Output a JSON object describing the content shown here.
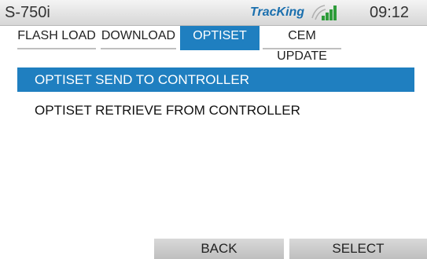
{
  "status_bar": {
    "device": "S-750i",
    "logo": "TracKing",
    "time": "09:12",
    "signal_icon": "signal-bars-icon",
    "accent_color": "#1f7fc0"
  },
  "tabs": [
    {
      "label": "FLASH LOAD"
    },
    {
      "label": "DOWNLOAD"
    },
    {
      "label": "OPTISET"
    },
    {
      "label": "CEM UPDATE"
    }
  ],
  "active_tab": "OPTISET",
  "menu": {
    "items": [
      {
        "label": "OPTISET SEND TO CONTROLLER"
      },
      {
        "label": "OPTISET RETRIEVE FROM CONTROLLER"
      }
    ],
    "selected_index": 0
  },
  "softkeys": {
    "back": "BACK",
    "select": "SELECT"
  }
}
